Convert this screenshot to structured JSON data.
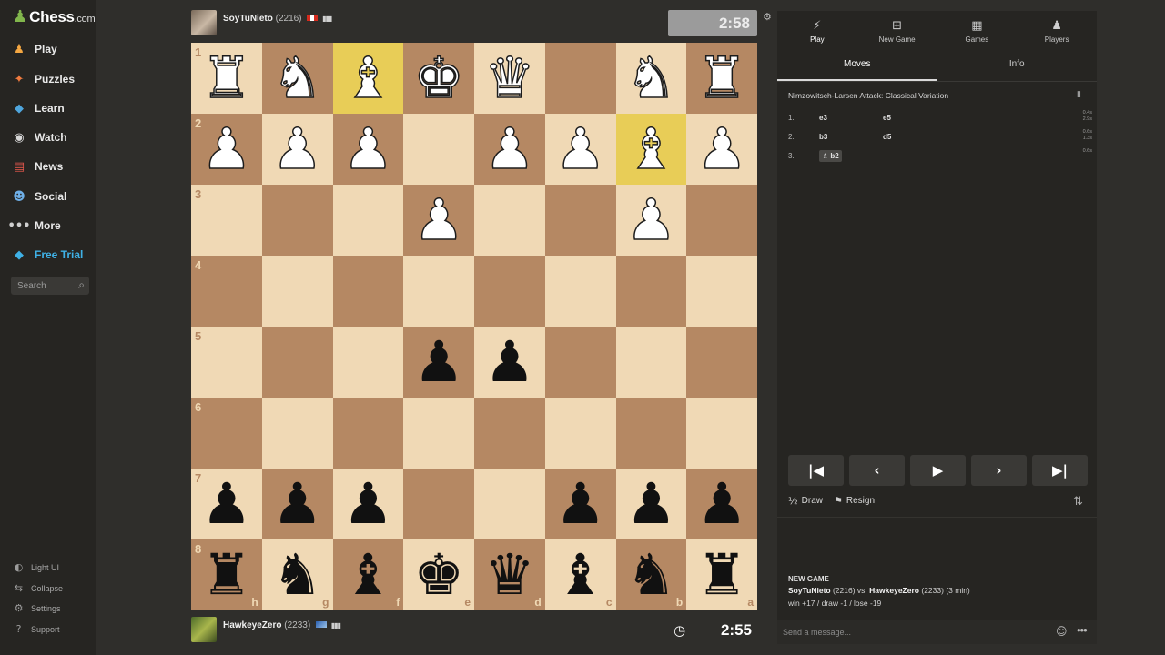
{
  "brand": {
    "name": "Chess",
    "suffix": ".com"
  },
  "sidebar": {
    "items": [
      {
        "label": "Play",
        "icon": "play-pawn-icon",
        "color": "#e8e8e8"
      },
      {
        "label": "Puzzles",
        "icon": "puzzle-icon",
        "color": "#e8e8e8"
      },
      {
        "label": "Learn",
        "icon": "learn-icon",
        "color": "#e8e8e8"
      },
      {
        "label": "Watch",
        "icon": "binoculars-icon",
        "color": "#e8e8e8"
      },
      {
        "label": "News",
        "icon": "news-icon",
        "color": "#e8e8e8"
      },
      {
        "label": "Social",
        "icon": "social-icon",
        "color": "#e8e8e8"
      },
      {
        "label": "More",
        "icon": "more-dots-icon",
        "color": "#e8e8e8"
      },
      {
        "label": "Free Trial",
        "icon": "diamond-icon",
        "color": "#3fb1e6"
      }
    ],
    "search_placeholder": "Search",
    "footer": [
      {
        "label": "Light UI",
        "icon": "contrast-icon"
      },
      {
        "label": "Collapse",
        "icon": "collapse-icon"
      },
      {
        "label": "Settings",
        "icon": "gear-icon"
      },
      {
        "label": "Support",
        "icon": "help-icon"
      }
    ]
  },
  "top_player": {
    "name": "SoyTuNieto",
    "rating": "(2216)",
    "clock": "2:58",
    "flag_colors": [
      "#d52b1e",
      "#ffffff",
      "#d52b1e"
    ]
  },
  "bottom_player": {
    "name": "HawkeyeZero",
    "rating": "(2233)",
    "clock": "2:55"
  },
  "board": {
    "orientation": "black-bottom",
    "rank_labels": [
      "1",
      "2",
      "3",
      "4",
      "5",
      "6",
      "7",
      "8"
    ],
    "file_labels": [
      "h",
      "g",
      "f",
      "e",
      "d",
      "c",
      "b",
      "a"
    ],
    "highlighted": [
      "f1",
      "b2"
    ],
    "rows": [
      [
        "wR",
        "wN",
        "wB",
        "wK",
        "wQ",
        "",
        "wN",
        "wR"
      ],
      [
        "wP",
        "wP",
        "wP",
        "",
        "wP",
        "wP",
        "wB",
        "wP"
      ],
      [
        "",
        "",
        "",
        "wP",
        "",
        "",
        "wP",
        ""
      ],
      [
        "",
        "",
        "",
        "",
        "",
        "",
        "",
        ""
      ],
      [
        "",
        "",
        "",
        "bP",
        "bP",
        "",
        "",
        ""
      ],
      [
        "",
        "",
        "",
        "",
        "",
        "",
        "",
        ""
      ],
      [
        "bP",
        "bP",
        "bP",
        "",
        "",
        "bP",
        "bP",
        "bP"
      ],
      [
        "bR",
        "bN",
        "bB",
        "bK",
        "bQ",
        "bB",
        "bN",
        "bR"
      ]
    ],
    "light_color": "#f0d9b5",
    "dark_color": "#b58863",
    "highlight_color": "#e8cd57"
  },
  "panel": {
    "tabs": [
      {
        "label": "Play",
        "icon": "bolt-icon"
      },
      {
        "label": "New Game",
        "icon": "plus-square-icon"
      },
      {
        "label": "Games",
        "icon": "board-grid-icon"
      },
      {
        "label": "Players",
        "icon": "players-icon"
      }
    ],
    "subtabs": [
      "Moves",
      "Info"
    ],
    "opening": "Nimzowitsch-Larsen Attack: Classical Variation",
    "moves": [
      {
        "num": "1.",
        "white": "e3",
        "black": "e5",
        "times": [
          "0.4s",
          "2.9s"
        ]
      },
      {
        "num": "2.",
        "white": "b3",
        "black": "d5",
        "times": [
          "0.6s",
          "1.3s"
        ]
      },
      {
        "num": "3.",
        "white": "b2",
        "black": "",
        "times": [
          "0.6s"
        ]
      }
    ],
    "controls": [
      "⏮",
      "◀",
      "▶",
      "▶",
      "⏭"
    ],
    "draw_label": "Draw",
    "resign_label": "Resign",
    "new_game": {
      "title": "NEW GAME",
      "white": "SoyTuNieto",
      "white_rating": "(2216)",
      "vs": "vs.",
      "black": "HawkeyeZero",
      "black_rating": "(2233)",
      "time": "(3 min)",
      "results": "win +17 / draw -1 / lose -19"
    },
    "message_placeholder": "Send a message..."
  }
}
